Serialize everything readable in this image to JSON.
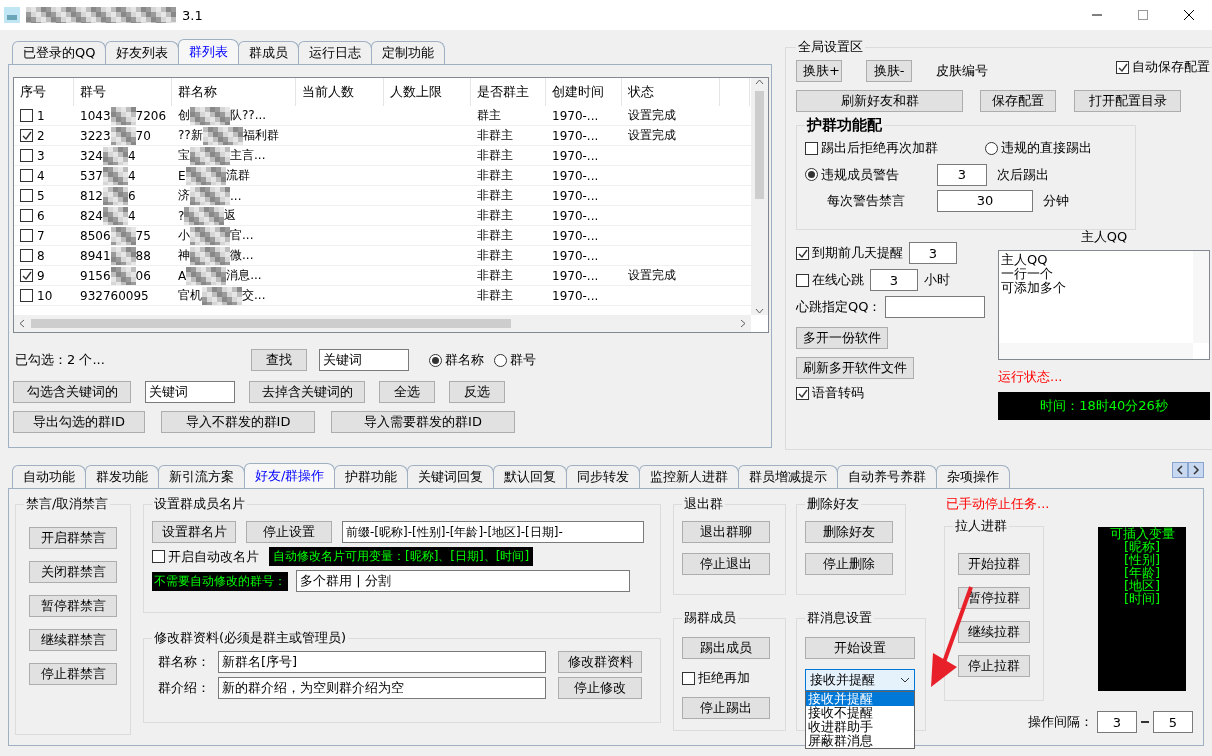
{
  "window": {
    "title_visible": "3.1"
  },
  "top_tabs": [
    {
      "label": "已登录的QQ",
      "selected": false
    },
    {
      "label": "好友列表",
      "selected": false
    },
    {
      "label": "群列表",
      "selected": true
    },
    {
      "label": "群成员",
      "selected": false
    },
    {
      "label": "运行日志",
      "selected": false
    },
    {
      "label": "定制功能",
      "selected": false
    }
  ],
  "group_table": {
    "columns": [
      "序号",
      "群号",
      "群名称",
      "当前人数",
      "人数上限",
      "是否群主",
      "创建时间",
      "状态"
    ],
    "rows": [
      {
        "checked": false,
        "index": "1",
        "group_id_start": "1043",
        "group_id_end": "7206",
        "name_start": "创",
        "name_end": "队??...",
        "owner": "群主",
        "created": "1970-...",
        "status": "设置完成"
      },
      {
        "checked": true,
        "index": "2",
        "group_id_start": "3223",
        "group_id_end": "70",
        "name_start": "??新",
        "name_end": "福利群",
        "owner": "非群主",
        "created": "1970-...",
        "status": "设置完成"
      },
      {
        "checked": false,
        "index": "3",
        "group_id_start": "324",
        "group_id_end": "4",
        "name_start": "宝",
        "name_end": "主言...",
        "owner": "非群主",
        "created": "1970-..."
      },
      {
        "checked": false,
        "index": "4",
        "group_id_start": "537",
        "group_id_end": "4",
        "name_start": "E",
        "name_end": "流群",
        "owner": "非群主",
        "created": "1970-..."
      },
      {
        "checked": false,
        "index": "5",
        "group_id_start": "812",
        "group_id_end": "6",
        "name_start": "济",
        "name_end": "...",
        "owner": "非群主",
        "created": "1970-..."
      },
      {
        "checked": false,
        "index": "6",
        "group_id_start": "824",
        "group_id_end": "4",
        "name_start": "?",
        "name_end": "返",
        "owner": "非群主",
        "created": "1970-..."
      },
      {
        "checked": false,
        "index": "7",
        "group_id_start": "8506",
        "group_id_end": "75",
        "name_start": "小",
        "name_end": "官...",
        "owner": "非群主",
        "created": "1970-..."
      },
      {
        "checked": false,
        "index": "8",
        "group_id_start": "8941",
        "group_id_end": "88",
        "name_start": "神",
        "name_end": "微...",
        "owner": "非群主",
        "created": "1970-..."
      },
      {
        "checked": true,
        "index": "9",
        "group_id_start": "9156",
        "group_id_end": "06",
        "name_start": "A",
        "name_end": "消息...",
        "owner": "非群主",
        "created": "1970-...",
        "status": "设置完成"
      },
      {
        "checked": false,
        "index": "10",
        "group_id_start": "932760095",
        "name_start": "官机",
        "name_end": "交...",
        "owner": "非群主",
        "created": "1970-..."
      }
    ]
  },
  "selection_summary": "已勾选：2 个...",
  "search": {
    "button": "查找",
    "value": "关键词"
  },
  "search_by": [
    {
      "label": "群名称",
      "selected": true
    },
    {
      "label": "群号",
      "selected": false
    }
  ],
  "keyword_select": {
    "button": "勾选含关键词的",
    "value": "关键词",
    "buttons": [
      "去掉含关键词的",
      "全选",
      "反选"
    ]
  },
  "id_buttons": [
    "导出勾选的群ID",
    "导入不群发的群ID",
    "导入需要群发的群ID"
  ],
  "global_settings": {
    "title": "全局设置区",
    "skin_buttons": [
      "换肤+",
      "换肤-"
    ],
    "skin_label": "皮肤编号",
    "auto_save": {
      "label": "自动保存配置",
      "checked": true
    },
    "action_buttons": [
      "刷新好友和群",
      "保存配置",
      "打开配置目录"
    ],
    "protect": {
      "title": "护群功能配",
      "reject_rejoin": {
        "label": "踢出后拒绝再次加群",
        "checked": false
      },
      "modes": [
        {
          "label": "违规的直接踢出",
          "selected": false
        },
        {
          "label": "违规成员警告",
          "selected": true
        }
      ],
      "warn_count": "3",
      "warn_suffix": "次后踢出",
      "mute_label": "每次警告禁言",
      "mute_minutes": "30",
      "mute_unit": "分钟"
    },
    "expiry_reminder": {
      "label": "到期前几天提醒",
      "checked": true,
      "value": "3"
    },
    "heartbeat": {
      "label": "在线心跳",
      "checked": false,
      "value": "3",
      "unit": "小时"
    },
    "heartbeat_qq": {
      "label": "心跳指定QQ："
    },
    "multi_buttons": [
      "多开一份软件",
      "刷新多开软件文件"
    ],
    "voice": {
      "label": "语音转码",
      "checked": true
    },
    "owner_qq": {
      "title": "主人QQ",
      "lines": [
        "主人QQ",
        "一行一个",
        "可添加多个"
      ]
    },
    "run_status": "运行状态...",
    "clock": "时间：18时40分26秒"
  },
  "bottom_tabs": [
    {
      "label": "自动功能",
      "selected": false
    },
    {
      "label": "群发功能",
      "selected": false
    },
    {
      "label": "新引流方案",
      "selected": false
    },
    {
      "label": "好友/群操作",
      "selected": true
    },
    {
      "label": "护群功能",
      "selected": false
    },
    {
      "label": "关键词回复",
      "selected": false
    },
    {
      "label": "默认回复",
      "selected": false
    },
    {
      "label": "同步转发",
      "selected": false
    },
    {
      "label": "监控新人进群",
      "selected": false
    },
    {
      "label": "群员增减提示",
      "selected": false
    },
    {
      "label": "自动养号养群",
      "selected": false
    },
    {
      "label": "杂项操作",
      "selected": false
    }
  ],
  "mute": {
    "title": "禁言/取消禁言",
    "buttons": [
      "开启群禁言",
      "关闭群禁言",
      "暂停群禁言",
      "继续群禁言",
      "停止群禁言"
    ]
  },
  "card": {
    "title": "设置群成员名片",
    "buttons": [
      "设置群名片",
      "停止设置"
    ],
    "template": "前缀-[昵称]-[性别]-[年龄]-[地区]-[日期]-",
    "auto": {
      "label": "开启自动改名片",
      "checked": false
    },
    "variables_hint": "自动修改名片可用变量：[昵称]、[日期]、[时间]",
    "exclude_label": "不需要自动修改的群号：",
    "exclude_value": "多个群用 | 分割"
  },
  "group_info": {
    "title": "修改群资料(必须是群主或管理员)",
    "fields": [
      {
        "label": "群名称：",
        "value": "新群名[序号]",
        "button": "修改群资料"
      },
      {
        "label": "群介绍：",
        "value": "新的群介绍，为空则群介绍为空",
        "button": "停止修改"
      }
    ]
  },
  "quit": {
    "title": "退出群",
    "buttons": [
      "退出群聊",
      "停止退出"
    ]
  },
  "delete_friend": {
    "title": "删除好友",
    "buttons": [
      "删除好友",
      "停止删除"
    ]
  },
  "kick": {
    "title": "踢群成员",
    "button": "踢出成员",
    "reject": {
      "label": "拒绝再加",
      "checked": false
    },
    "stop": "停止踢出"
  },
  "message_settings": {
    "title": "群消息设置",
    "button": "开始设置",
    "value": "接收并提醒",
    "options": [
      {
        "label": "接收并提醒",
        "selected": true
      },
      {
        "label": "接收不提醒",
        "selected": false
      },
      {
        "label": "收进群助手",
        "selected": false
      },
      {
        "label": "屏蔽群消息",
        "selected": false
      }
    ]
  },
  "task_status": "已手动停止任务...",
  "invite": {
    "title": "拉人进群",
    "buttons": [
      "开始拉群",
      "暂停拉群",
      "继续拉群",
      "停止拉群"
    ]
  },
  "variables": [
    "可插入变量",
    "[昵称]",
    "[性别]",
    "[年龄]",
    "[地区]",
    "[时间]"
  ],
  "interval": {
    "label": "操作间隔：",
    "from": "3",
    "to": "5"
  }
}
